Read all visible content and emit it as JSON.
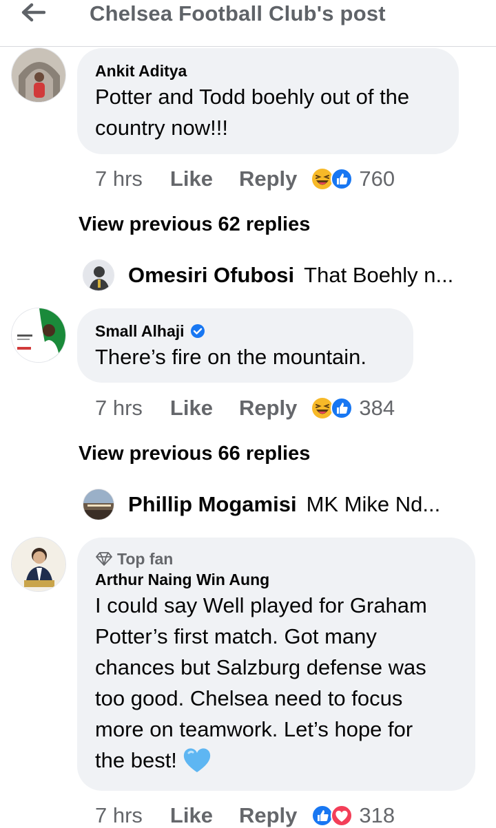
{
  "header": {
    "title": "Chelsea Football Club's post"
  },
  "comments": [
    {
      "author": "Ankit Aditya",
      "text": [
        "Potter and Todd boehly out of the",
        "country now!!!"
      ],
      "time": "7 hrs",
      "like": "Like",
      "reply": "Reply",
      "reaction_count": "760",
      "reactions": [
        "haha",
        "like"
      ],
      "view_previous": "View previous 62 replies",
      "latest_reply": {
        "name": "Omesiri Ofubosi",
        "text": "That Boehly n..."
      }
    },
    {
      "author": "Small Alhaji",
      "verified": true,
      "text": [
        "There’s fire on the mountain."
      ],
      "time": "7 hrs",
      "like": "Like",
      "reply": "Reply",
      "reaction_count": "384",
      "reactions": [
        "haha",
        "like"
      ],
      "view_previous": "View previous 66 replies",
      "latest_reply": {
        "name": "Phillip Mogamisi",
        "text": "MK Mike Nd..."
      }
    },
    {
      "badge": "Top fan",
      "author": "Arthur Naing Win Aung",
      "text": [
        "I could say Well played for Graham",
        "Potter’s first match. Got many",
        "chances but Salzburg defense was",
        "too good. Chelsea need to focus",
        "more on teamwork. Let’s hope for",
        "the best!"
      ],
      "emoji": "blue-heart",
      "time": "7 hrs",
      "like": "Like",
      "reply": "Reply",
      "reaction_count": "318",
      "reactions": [
        "like",
        "love"
      ]
    }
  ],
  "colors": {
    "bubble": "#f0f2f5",
    "secondary_text": "#65676b",
    "like_blue": "#1877f2",
    "love_red": "#f33e58",
    "haha_yellow": "#f7b928"
  }
}
